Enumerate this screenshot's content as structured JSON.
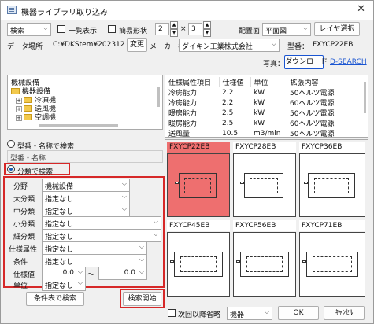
{
  "window": {
    "title": "機器ライブラリ取り込み",
    "close_glyph": "✕"
  },
  "toolbar": {
    "search_mode": "検索",
    "list_view_label": "一覧表示",
    "simple_shape_label": "簡易形状",
    "grid_rows": "2",
    "times": "×",
    "grid_cols": "3",
    "placement_label": "配置面",
    "placement_value": "平面図",
    "layer_select_label": "レイヤ選択"
  },
  "data_location": {
    "label": "データ場所",
    "path": "C:¥DKStem¥202312",
    "change_label": "変更",
    "maker_label": "メーカー名",
    "maker_value": "ダイキン工業株式会社",
    "model_label": "型番：",
    "model_value": "FXYCP22EB"
  },
  "photo": {
    "label": "写真：",
    "download_label": "ダウンロード",
    "dsearch_label": "D-SEARCH"
  },
  "tree": {
    "root": "機械設備",
    "items": [
      {
        "label": "機器設備",
        "expander": ""
      },
      {
        "label": "冷凍機",
        "expander": "+"
      },
      {
        "label": "送風機",
        "expander": "+"
      },
      {
        "label": "空調機",
        "expander": "+"
      }
    ]
  },
  "attributes": {
    "headers": [
      "仕様属性項目",
      "仕様値",
      "単位",
      "拡張内容"
    ],
    "rows": [
      [
        "冷房能力",
        "2.2",
        "kW",
        "50ヘルツ電源"
      ],
      [
        "冷房能力",
        "2.2",
        "kW",
        "60ヘルツ電源"
      ],
      [
        "暖房能力",
        "2.5",
        "kW",
        "50ヘルツ電源"
      ],
      [
        "暖房能力",
        "2.5",
        "kW",
        "60ヘルツ電源"
      ],
      [
        "送風量",
        "10.5",
        "m3/min",
        "50ヘルツ電源"
      ]
    ]
  },
  "model_name_search": {
    "label": "型番・名称で検索",
    "field_label": "型番・名称"
  },
  "classification_search": {
    "label": "分類で検索",
    "fields": [
      {
        "label": "分野",
        "value": "機械設備"
      },
      {
        "label": "大分類",
        "value": "指定なし"
      },
      {
        "label": "中分類",
        "value": "指定なし"
      },
      {
        "label": "小分類",
        "value": "指定なし"
      },
      {
        "label": "細分類",
        "value": "指定なし"
      },
      {
        "label": "仕様属性",
        "value": "指定なし"
      },
      {
        "label": "条件",
        "value": "指定なし"
      }
    ],
    "spec_value_label": "仕様値",
    "spec_from": "0.0",
    "tilde": "～",
    "spec_to": "0.0",
    "unit_label": "単位",
    "unit_value": "指定なし",
    "condition_table_button": "条件表で検索",
    "start_search_button": "検索開始"
  },
  "results": [
    {
      "name": "FXYCP22EB",
      "selected": true
    },
    {
      "name": "FXYCP28EB",
      "selected": false
    },
    {
      "name": "FXYCP36EB",
      "selected": false
    },
    {
      "name": "FXYCP45EB",
      "selected": false
    },
    {
      "name": "FXYCP56EB",
      "selected": false
    },
    {
      "name": "FXYCP71EB",
      "selected": false
    }
  ],
  "footer": {
    "skip_next_label": "次回以降省略",
    "category_value": "機器",
    "ok_label": "OK",
    "cancel_label": "ｷｬﾝｾﾙ"
  },
  "colors": {
    "selection": "#ee6f6f",
    "highlight_border": "#d62828",
    "link": "#1a55d1"
  }
}
